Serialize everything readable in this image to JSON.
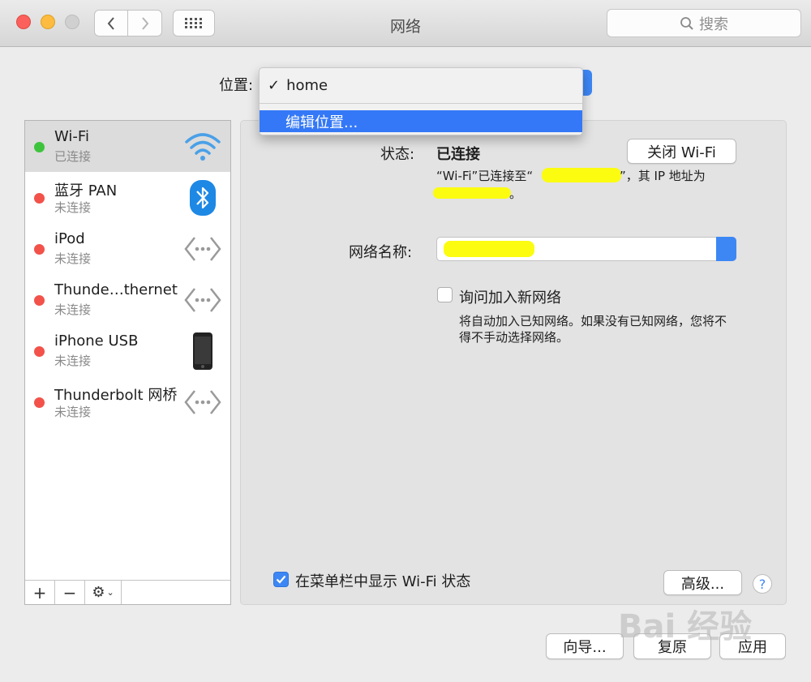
{
  "window": {
    "title": "网络"
  },
  "search": {
    "placeholder": "搜索"
  },
  "location": {
    "label": "位置:",
    "current": "home",
    "menu_edit": "编辑位置..."
  },
  "services": [
    {
      "name": "Wi-Fi",
      "status": "已连接",
      "dot": "#3ec43c",
      "icon": "wifi-icon"
    },
    {
      "name": "蓝牙 PAN",
      "status": "未连接",
      "dot": "#f2524a",
      "icon": "bluetooth-icon"
    },
    {
      "name": "iPod",
      "status": "未连接",
      "dot": "#f2524a",
      "icon": "ethernet-arrows-icon"
    },
    {
      "name": "Thunde…thernet",
      "status": "未连接",
      "dot": "#f2524a",
      "icon": "ethernet-arrows-icon"
    },
    {
      "name": "iPhone USB",
      "status": "未连接",
      "dot": "#f2524a",
      "icon": "iphone-icon"
    },
    {
      "name": "Thunderbolt 网桥",
      "status": "未连接",
      "dot": "#f2524a",
      "icon": "ethernet-arrows-icon"
    }
  ],
  "list_controls": {
    "add": "+",
    "remove": "−"
  },
  "detail": {
    "status_label": "状态:",
    "status_value": "已连接",
    "wifi_off_button": "关闭 Wi-Fi",
    "status_desc_1a": "“Wi-Fi”已连接至“",
    "status_desc_1b": "”，其 IP 地址为",
    "status_desc_2": "。",
    "network_name_label": "网络名称:",
    "ask_join_label": "询问加入新网络",
    "ask_join_desc_1": "将自动加入已知网络。如果没有已知网络，您将不",
    "ask_join_desc_2": "得不手动选择网络。",
    "show_status_label": "在菜单栏中显示 Wi-Fi 状态",
    "advanced_button": "高级...",
    "help": "?"
  },
  "footer": {
    "assist_button": "向导...",
    "revert_button": "复原",
    "apply_button": "应用"
  },
  "colors": {
    "accent": "#3d87f5",
    "connected": "#3ec43c",
    "disconnected": "#f2524a"
  },
  "watermark": "Bai 经验"
}
